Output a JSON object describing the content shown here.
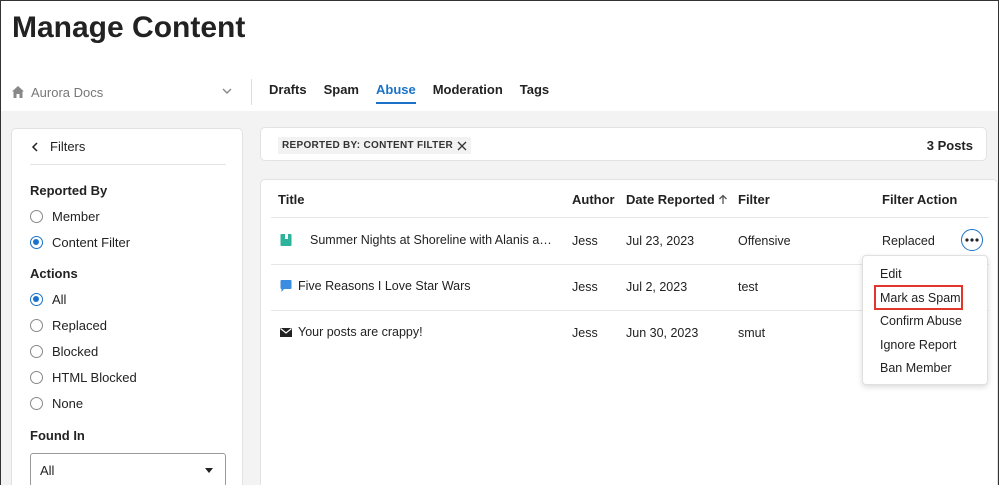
{
  "page": {
    "title": "Manage Content"
  },
  "community": {
    "name": "Aurora Docs"
  },
  "tabs": [
    {
      "label": "Drafts",
      "active": false
    },
    {
      "label": "Spam",
      "active": false
    },
    {
      "label": "Abuse",
      "active": true
    },
    {
      "label": "Moderation",
      "active": false
    },
    {
      "label": "Tags",
      "active": false
    }
  ],
  "filters": {
    "back_label": "Filters",
    "reported_by": {
      "label": "Reported By",
      "options": [
        {
          "label": "Member",
          "checked": false
        },
        {
          "label": "Content Filter",
          "checked": true
        }
      ]
    },
    "actions": {
      "label": "Actions",
      "options": [
        {
          "label": "All",
          "checked": true
        },
        {
          "label": "Replaced",
          "checked": false
        },
        {
          "label": "Blocked",
          "checked": false
        },
        {
          "label": "HTML Blocked",
          "checked": false
        },
        {
          "label": "None",
          "checked": false
        }
      ]
    },
    "found_in": {
      "label": "Found In",
      "selected": "All"
    }
  },
  "chip": {
    "label": "REPORTED BY: CONTENT FILTER"
  },
  "post_count": "3 Posts",
  "table": {
    "headers": {
      "title": "Title",
      "author": "Author",
      "date": "Date Reported",
      "filter": "Filter",
      "action": "Filter Action"
    },
    "rows": [
      {
        "icon": "book-icon",
        "title": "Summer Nights at Shoreline with Alanis and…",
        "author": "Jess",
        "date": "Jul 23, 2023",
        "filter": "Offensive",
        "action": "Replaced"
      },
      {
        "icon": "message-icon",
        "title": "Five Reasons I Love Star Wars",
        "author": "Jess",
        "date": "Jul 2, 2023",
        "filter": "test",
        "action": ""
      },
      {
        "icon": "envelope-icon",
        "title": "Your posts are crappy!",
        "author": "Jess",
        "date": "Jun 30, 2023",
        "filter": "smut",
        "action": ""
      }
    ]
  },
  "menu": {
    "items": [
      "Edit",
      "Mark as Spam",
      "Confirm Abuse",
      "Ignore Report",
      "Ban Member"
    ],
    "highlighted": "Mark as Spam"
  },
  "colors": {
    "accent": "#1a73c8",
    "highlight": "#e0362b",
    "background": "#f3f3f3"
  }
}
